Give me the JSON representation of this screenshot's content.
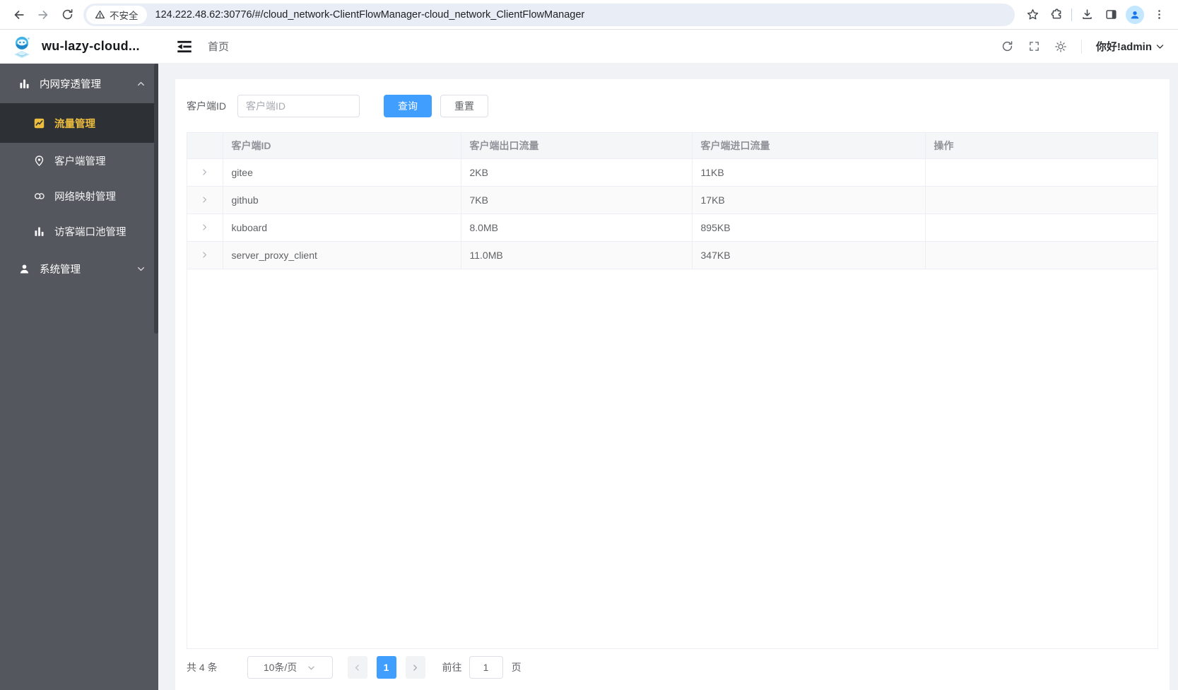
{
  "colors": {
    "accent": "#409eff",
    "sidebar-bg": "#54575d",
    "sidebar-active-bg": "#2d3034",
    "sidebar-active-text": "#edbd3f",
    "page-bg": "#f0f2f5",
    "border": "#ebeef5",
    "omnibox-bg": "#e9eef6",
    "stripe": "#fafafa",
    "th-text": "#909399",
    "body-text": "#606266"
  },
  "browser": {
    "security_label": "不安全",
    "url": "124.222.48.62:30776/#/cloud_network-ClientFlowManager-cloud_network_ClientFlowManager"
  },
  "header": {
    "app_title": "wu-lazy-cloud...",
    "breadcrumb": "首页",
    "greeting": "你好!admin"
  },
  "sidebar": {
    "groups": [
      {
        "label": "内网穿透管理",
        "items": [
          {
            "label": "流量管理"
          },
          {
            "label": "客户端管理"
          },
          {
            "label": "网络映射管理"
          },
          {
            "label": "访客端口池管理"
          }
        ]
      },
      {
        "label": "系统管理"
      }
    ]
  },
  "filter": {
    "label": "客户端ID",
    "placeholder": "客户端ID",
    "search_label": "查询",
    "reset_label": "重置"
  },
  "table": {
    "columns": [
      "客户端ID",
      "客户端出口流量",
      "客户端进口流量",
      "操作"
    ],
    "rows": [
      {
        "client_id": "gitee",
        "outbound": "2KB",
        "inbound": "11KB"
      },
      {
        "client_id": "github",
        "outbound": "7KB",
        "inbound": "17KB"
      },
      {
        "client_id": "kuboard",
        "outbound": "8.0MB",
        "inbound": "895KB"
      },
      {
        "client_id": "server_proxy_client",
        "outbound": "11.0MB",
        "inbound": "347KB"
      }
    ]
  },
  "pagination": {
    "total": "共 4 条",
    "page_size": "10条/页",
    "current_page": "1",
    "goto_label": "前往",
    "goto_value": "1",
    "unit_label": "页"
  }
}
